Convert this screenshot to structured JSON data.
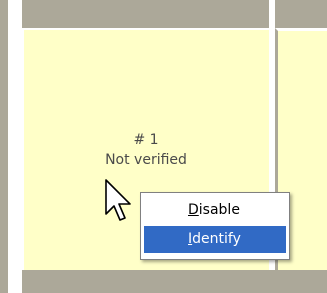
{
  "monitor": {
    "number_label": "# 1",
    "status_label": "Not verified"
  },
  "context_menu": {
    "items": [
      {
        "label": "Disable",
        "mnemonic": "D",
        "rest": "isable",
        "highlighted": false
      },
      {
        "label": "Identify",
        "mnemonic": "I",
        "rest": "dentify",
        "highlighted": true
      }
    ]
  },
  "colors": {
    "panel_background": "#ffffc8",
    "frame_gray": "#aca899",
    "menu_highlight": "#316ac5"
  },
  "icons": {
    "cursor": "arrow-cursor-icon"
  }
}
